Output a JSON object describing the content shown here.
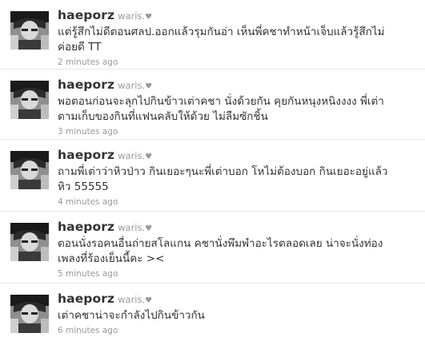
{
  "tweets": [
    {
      "username": "haeporz",
      "fullname": "waris.",
      "heart": "♥",
      "lines": [
        "แต่รู้สึกไม่ดีตอนศลป.ออกแล้วรุมกันอ่า เห็นพี่คชาทำหน้าเจ็บแล้วรู้สึกไม่",
        "ค่อยดี TT"
      ],
      "time": "2 minutes ago"
    },
    {
      "username": "haeporz",
      "fullname": "waris.",
      "heart": "♥",
      "lines": [
        "พอตอนก่อนจะลุกไปกินข้าวเต่าคชา นั่งด้วยกัน คุยกันหนุงหนิงงงง พี่เต่า",
        "ตามเก็บของกินที่แฟนคลับให้ด้วย ไม่ลืมซักชิ้น"
      ],
      "time": "3 minutes ago"
    },
    {
      "username": "haeporz",
      "fullname": "waris.",
      "heart": "♥",
      "lines": [
        "ถามพี่เต่าว่าหิวป่าว กินเยอะๆนะพี่เต่าบอก โหไม่ต้องบอก กินเยอะอยู่แล้ว",
        "หิว 55555"
      ],
      "time": "4 minutes ago"
    },
    {
      "username": "haeporz",
      "fullname": "waris.",
      "heart": "♥",
      "lines": [
        "ตอนนั่งรอคนอื่นถ่ายสโลแกน คชานั่งพึมพำอะไรตลอดเลย น่าจะนั่งท่อง",
        "เพลงที่ร้องเย็นนี้คะ ><"
      ],
      "time": "5 minutes ago"
    },
    {
      "username": "haeporz",
      "fullname": "waris.",
      "heart": "♥",
      "lines": [
        "เต่าคชาน่าจะกำลังไปกินข้าวกัน"
      ],
      "time": "6 minutes ago"
    }
  ]
}
